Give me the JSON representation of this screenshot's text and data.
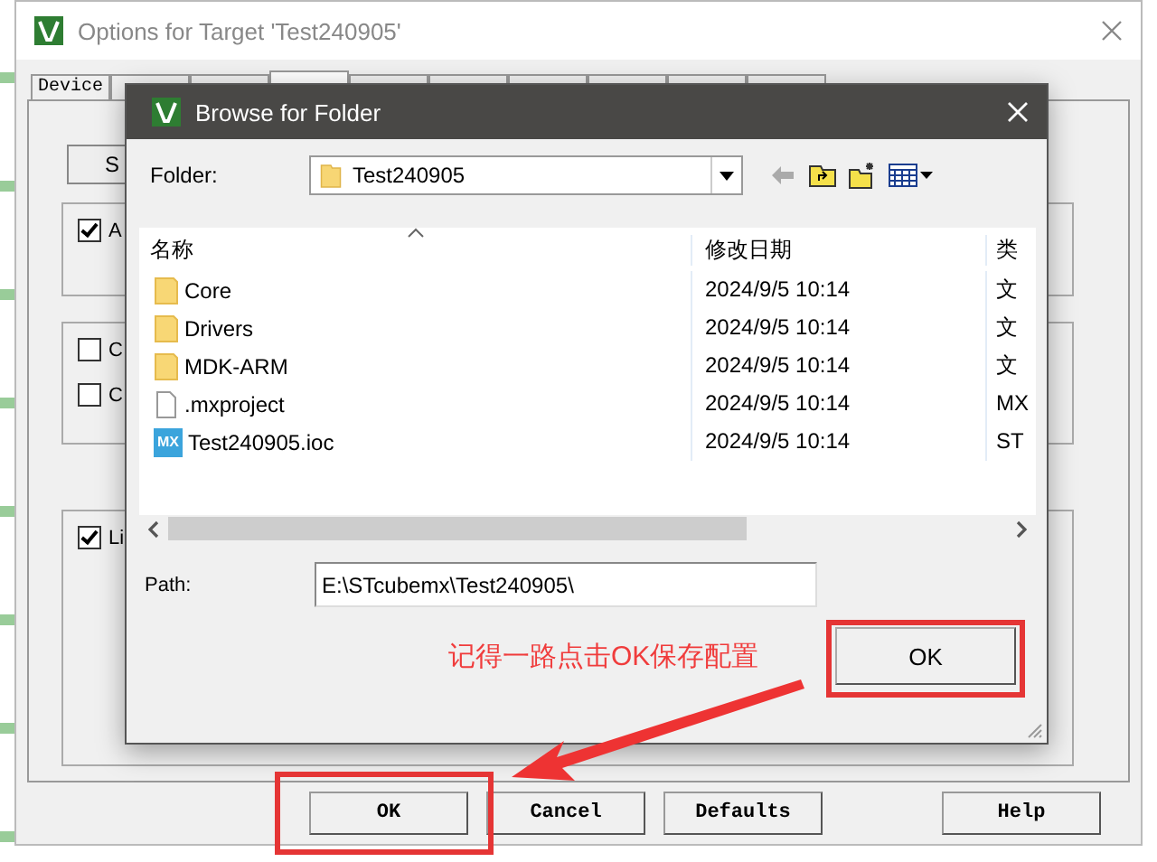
{
  "window": {
    "title": "Options for Target 'Test240905'"
  },
  "tabs": [
    {
      "label": "Device",
      "selected": false
    },
    {
      "selected": false
    },
    {
      "selected": false
    },
    {
      "selected": true
    },
    {
      "selected": false
    },
    {
      "selected": false
    },
    {
      "selected": false
    },
    {
      "selected": false
    },
    {
      "selected": false
    },
    {
      "selected": false
    }
  ],
  "panel": {
    "button": "S",
    "checkboxes": [
      {
        "label": "A",
        "checked": true
      },
      {
        "label": "C",
        "checked": false
      },
      {
        "label": "C",
        "checked": false
      },
      {
        "label": "Li",
        "checked": true
      }
    ]
  },
  "buttons": [
    "OK",
    "Cancel",
    "Defaults",
    "Help"
  ],
  "dialog": {
    "title": "Browse for Folder",
    "folder_label": "Folder:",
    "folder": "Test240905",
    "columns": [
      "名称",
      "修改日期",
      "类"
    ],
    "rows": [
      {
        "kind": "folder",
        "name": "Core",
        "date": "2024/9/5 10:14",
        "type": "文"
      },
      {
        "kind": "folder",
        "name": "Drivers",
        "date": "2024/9/5 10:14",
        "type": "文"
      },
      {
        "kind": "folder",
        "name": "MDK-ARM",
        "date": "2024/9/5 10:14",
        "type": "文"
      },
      {
        "kind": "file",
        "name": ".mxproject",
        "date": "2024/9/5 10:14",
        "type": "MX"
      },
      {
        "kind": "mx",
        "icon_label": "MX",
        "name": "Test240905.ioc",
        "date": "2024/9/5 10:14",
        "type": "ST"
      }
    ],
    "path_label": "Path:",
    "path": "E:\\STcubemx\\Test240905\\",
    "ok": "OK"
  },
  "annotation": {
    "text": "记得一路点击OK保存配置"
  }
}
